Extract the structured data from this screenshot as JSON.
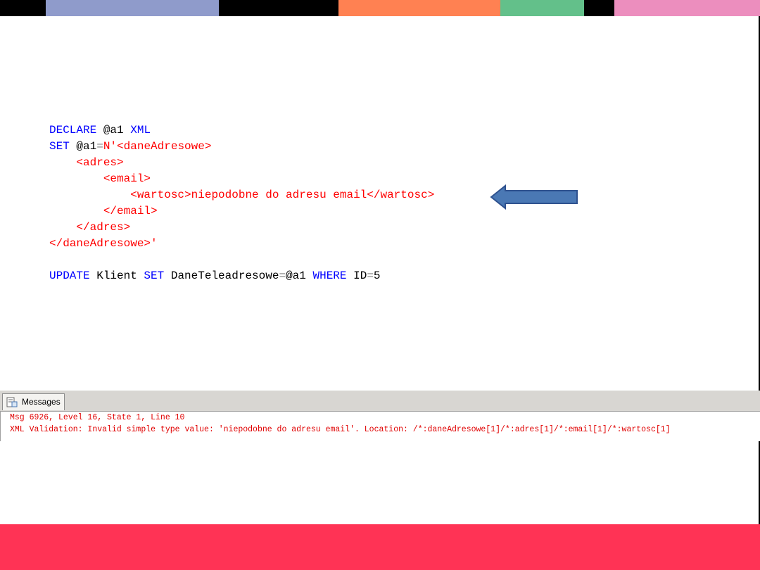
{
  "colors": {
    "strip": [
      "#000000",
      "#8f9bcb",
      "#000000",
      "#ff8152",
      "#63c08a",
      "#000000",
      "#ec8ebe"
    ],
    "keyword": "#0000ff",
    "string": "#ff0000",
    "error": "#e00000",
    "bottom_bar": "#ff3355",
    "arrow_fill": "#4a78b4",
    "arrow_stroke": "#2f528f"
  },
  "code": {
    "l1": {
      "k1": "DECLARE",
      "t1": " @a1 ",
      "k2": "XML"
    },
    "l2": {
      "k1": "SET",
      "t1": " @a1",
      "o1": "=",
      "s1": "N'<daneAdresowe>"
    },
    "l3": {
      "s1": "    <adres>"
    },
    "l4": {
      "s1": "        <email>"
    },
    "l5": {
      "s1": "            <wartosc>niepodobne do adresu email</wartosc>"
    },
    "l6": {
      "s1": "        </email>"
    },
    "l7": {
      "s1": "    </adres>"
    },
    "l8": {
      "s1": "</daneAdresowe>'"
    },
    "l10": {
      "k1": "UPDATE",
      "t1": " Klient ",
      "k2": "SET",
      "t2": " DaneTeleadresowe",
      "o1": "=",
      "t3": "@a1 ",
      "k3": "WHERE",
      "t4": " ID",
      "o2": "=",
      "t5": "5"
    }
  },
  "messages": {
    "tab_label": "Messages",
    "tab_icon": "messages-icon",
    "line1": "Msg 6926, Level 16, State 1, Line 10",
    "line2": "XML Validation: Invalid simple type value: 'niepodobne do adresu email'. Location: /*:daneAdresowe[1]/*:adres[1]/*:email[1]/*:wartosc[1]"
  },
  "annotation": {
    "arrow_icon": "left-arrow-icon"
  }
}
